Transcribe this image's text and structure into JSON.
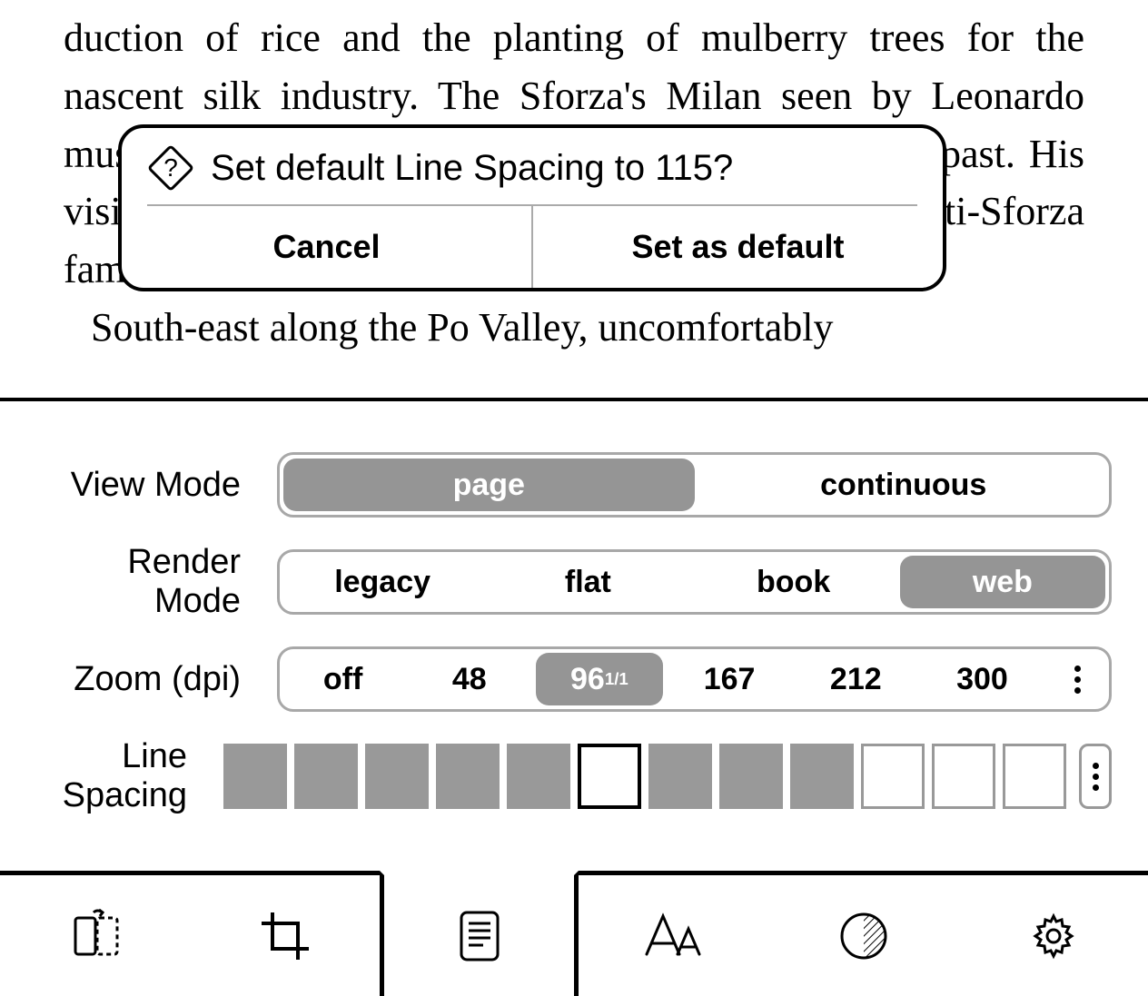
{
  "book_text": "duction of rice and the planting of mulberry trees for the nascent silk industry. The Sforza's Milan seen by Leonardo must be the one etched in Veronese's memory of the past. His visit predates the late fifteenth century and the Visconti-Sforza family's absorption by the Spanish.",
  "book_text2": "South-east along the Po Valley, uncomfortably",
  "dialog": {
    "title": "Set default Line Spacing to 115?",
    "cancel": "Cancel",
    "confirm": "Set as default"
  },
  "settings": {
    "view_mode": {
      "label": "View Mode",
      "options": [
        "page",
        "continuous"
      ],
      "selected": "page"
    },
    "render_mode": {
      "label": "Render Mode",
      "options": [
        "legacy",
        "flat",
        "book",
        "web"
      ],
      "selected": "web"
    },
    "zoom": {
      "label": "Zoom (dpi)",
      "options": [
        "off",
        "48",
        "96",
        "167",
        "212",
        "300"
      ],
      "selected": "96",
      "selected_sup": "1/1"
    },
    "line_spacing": {
      "label": "Line Spacing",
      "filled": 8,
      "current_index": 5,
      "total": 12
    }
  },
  "tabs": {
    "items": [
      "rotation",
      "crop",
      "page-layout",
      "typography",
      "contrast",
      "settings"
    ],
    "active": "page-layout"
  }
}
